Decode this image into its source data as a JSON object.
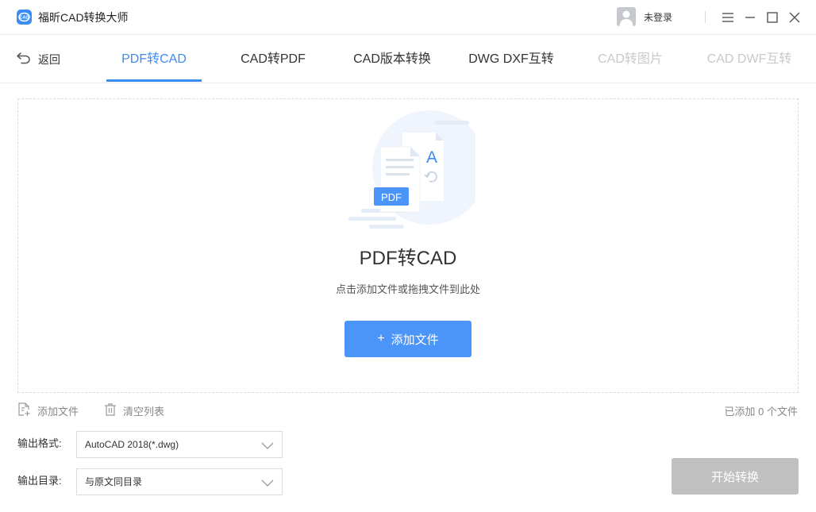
{
  "app": {
    "title": "福昕CAD转换大师",
    "logo_text": "CAD",
    "accent_color": "#3c8cf5"
  },
  "user": {
    "login_label": "未登录",
    "avatar_icon": "user-avatar-icon"
  },
  "window_controls": [
    "menu-icon",
    "minimize-icon",
    "maximize-icon",
    "close-icon"
  ],
  "nav": {
    "back_label": "返回",
    "tabs": [
      {
        "label": "PDF转CAD",
        "state": "active"
      },
      {
        "label": "CAD转PDF",
        "state": "normal"
      },
      {
        "label": "CAD版本转换",
        "state": "normal"
      },
      {
        "label": "DWG DXF互转",
        "state": "normal"
      },
      {
        "label": "CAD转图片",
        "state": "disabled"
      },
      {
        "label": "CAD DWF互转",
        "state": "disabled"
      }
    ]
  },
  "dropzone": {
    "illustration": {
      "pdf_badge": "PDF",
      "cad_letter": "A"
    },
    "title": "PDF转CAD",
    "subtitle": "点击添加文件或拖拽文件到此处",
    "add_button_plus": "+",
    "add_button_label": "添加文件"
  },
  "toolbar": {
    "add_file_label": "添加文件",
    "clear_list_label": "清空列表",
    "file_count_text": "已添加 0 个文件"
  },
  "output": {
    "format_label": "输出格式:",
    "format_value": "AutoCAD 2018(*.dwg)",
    "dir_label": "输出目录:",
    "dir_value": "与原文同目录"
  },
  "start_button_label": "开始转换"
}
